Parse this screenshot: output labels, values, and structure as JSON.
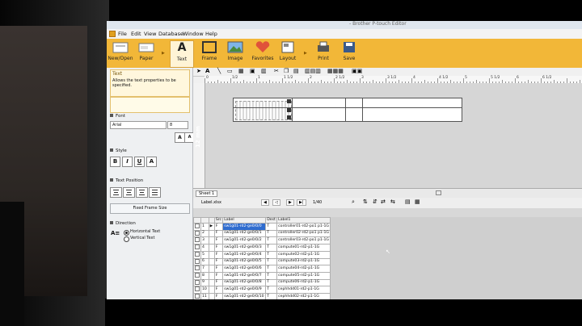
{
  "window": {
    "title_fragment": "- Brother P-touch Editor"
  },
  "menu": [
    "File",
    "Edit",
    "View",
    "Database",
    "Window",
    "Help"
  ],
  "ribbon": {
    "new_open": "New/Open",
    "paper": "Paper",
    "text": "Text",
    "frame": "Frame",
    "image": "Image",
    "favorites": "Favorites",
    "layout": "Layout",
    "print": "Print",
    "save": "Save"
  },
  "panel": {
    "section_title": "Text",
    "description": "Allows the text properties to be specified.",
    "font_header": "Font",
    "font_name": "Arial",
    "font_size": "8",
    "style_header": "Style",
    "style_buttons": [
      "B",
      "I",
      "U",
      "A"
    ],
    "text_position_header": "Text Position",
    "fixed_frame_size": "Fixed Frame Size",
    "direction_header": "Direction",
    "horizontal_text": "Horizontal Text",
    "vertical_text": "Vertical Text"
  },
  "ruler": {
    "labels": [
      "0",
      "1/2",
      "1",
      "1 1/2",
      "2",
      "2 1/2",
      "3",
      "3 1/2",
      "4",
      "4 1/2",
      "5",
      "5 1/2",
      "6",
      "6 1/2"
    ]
  },
  "tape": {
    "width_label": "12 mm"
  },
  "sheet_tab": "Sheet 1",
  "database": {
    "file": "Label.xlsx",
    "record_counter": "1/40",
    "columns": [
      "Src",
      "Label",
      "Dest",
      "Label1"
    ],
    "rows": [
      {
        "n": "1",
        "src": "F",
        "label": "sw1g01-rd2-ge0/0/0",
        "dest": "T",
        "label1": "controller01-rd2-po1 p1-1G"
      },
      {
        "n": "2",
        "src": "F",
        "label": "sw1g01-rd2-ge0/0/1",
        "dest": "T",
        "label1": "controller02-rd2-po1 p1-1G"
      },
      {
        "n": "3",
        "src": "F",
        "label": "sw1g01-rd2-ge0/0/2",
        "dest": "T",
        "label1": "controller03-rd2-po1 p1-1G"
      },
      {
        "n": "4",
        "src": "F",
        "label": "sw1g01-rd2-ge0/0/3",
        "dest": "T",
        "label1": "compute01-rd2-p1-1G"
      },
      {
        "n": "5",
        "src": "F",
        "label": "sw1g01-rd2-ge0/0/4",
        "dest": "T",
        "label1": "compute02-rd2-p1-1G"
      },
      {
        "n": "6",
        "src": "F",
        "label": "sw1g01-rd2-ge0/0/5",
        "dest": "T",
        "label1": "compute03-rd2-p1-1G"
      },
      {
        "n": "7",
        "src": "F",
        "label": "sw1g01-rd2-ge0/0/6",
        "dest": "T",
        "label1": "compute04-rd2-p1-1G"
      },
      {
        "n": "8",
        "src": "F",
        "label": "sw1g01-rd2-ge0/0/7",
        "dest": "T",
        "label1": "compute05-rd2-p1-1G"
      },
      {
        "n": "9",
        "src": "F",
        "label": "sw1g01-rd2-ge0/0/8",
        "dest": "T",
        "label1": "compute06-rd2-p1-1G"
      },
      {
        "n": "10",
        "src": "F",
        "label": "sw1g01-rd2-ge0/0/9",
        "dest": "T",
        "label1": "cephhdd01-rd2-p1-1G"
      },
      {
        "n": "11",
        "src": "F",
        "label": "sw1g01-rd2-ge0/0/10",
        "dest": "T",
        "label1": "cephhdd02-rd2-p1-1G"
      },
      {
        "n": "12",
        "src": "F",
        "label": "sw1g01-rd2-ge0/0/11",
        "dest": "T",
        "label1": "cephhdd03-rd2-p1-1G"
      },
      {
        "n": "13",
        "src": "F",
        "label": "sw1g01-rd2-ge0/0/12",
        "dest": "T",
        "label1": "cephhdd04-rd2-p1-1G"
      }
    ]
  },
  "colors": {
    "ribbon": "#f2b738",
    "selection": "#2f6ccf",
    "canvas": "#d6d6d6"
  }
}
